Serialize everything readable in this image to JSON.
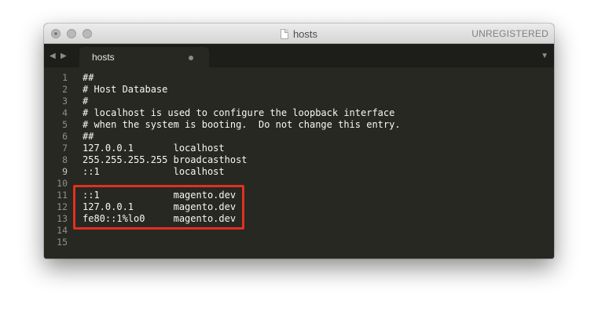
{
  "window": {
    "title": "hosts",
    "registration": "UNREGISTERED",
    "icons": {
      "close": "close-icon",
      "minimize": "minimize-icon",
      "maximize": "maximize-icon",
      "document": "document-icon"
    }
  },
  "tabbar": {
    "nav_left": "◀",
    "nav_right": "▶",
    "dropdown": "▼",
    "tabs": [
      {
        "label": "hosts",
        "modified": true
      }
    ]
  },
  "editor": {
    "active_line": 9,
    "highlight_color": "#e0311f",
    "lines": [
      {
        "num": "1",
        "text": "##"
      },
      {
        "num": "2",
        "text": "# Host Database"
      },
      {
        "num": "3",
        "text": "#"
      },
      {
        "num": "4",
        "text": "# localhost is used to configure the loopback interface"
      },
      {
        "num": "5",
        "text": "# when the system is booting.  Do not change this entry."
      },
      {
        "num": "6",
        "text": "##"
      },
      {
        "num": "7",
        "text": "127.0.0.1       localhost"
      },
      {
        "num": "8",
        "text": "255.255.255.255 broadcasthost"
      },
      {
        "num": "9",
        "text": "::1             localhost"
      },
      {
        "num": "10",
        "text": ""
      },
      {
        "num": "11",
        "text": "::1             magento.dev"
      },
      {
        "num": "12",
        "text": "127.0.0.1       magento.dev"
      },
      {
        "num": "13",
        "text": "fe80::1%lo0     magento.dev"
      },
      {
        "num": "14",
        "text": ""
      },
      {
        "num": "15",
        "text": ""
      }
    ]
  }
}
